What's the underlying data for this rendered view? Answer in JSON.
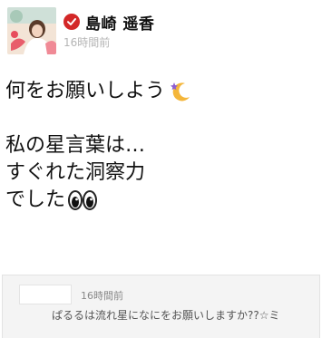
{
  "post": {
    "author_name": "島崎 遥香",
    "time": "16時間前",
    "lines": [
      "何をお願いしよう",
      "",
      "私の星言葉は…",
      "すぐれた洞察力",
      "でした"
    ],
    "emoji": {
      "moon": "moon-star-emoji",
      "eyes": "eyes-emoji"
    }
  },
  "comment": {
    "time": "16時間前",
    "text": "ぱるるは流れ星になにをお願いしますか??☆ミ"
  },
  "colors": {
    "verified": "#d32727",
    "timestamp": "#b5b5b5",
    "comment_bg": "#f4f4f4"
  }
}
